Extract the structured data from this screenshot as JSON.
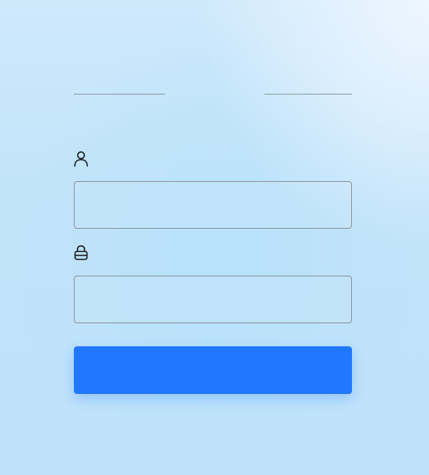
{
  "login": {
    "divider_text": "",
    "username": {
      "icon": "user-icon",
      "label": "",
      "value": "",
      "placeholder": ""
    },
    "password": {
      "icon": "lock-icon",
      "label": "",
      "value": "",
      "placeholder": ""
    },
    "submit_label": ""
  },
  "colors": {
    "accent": "#2177ff",
    "input_border": "#8d939a",
    "divider": "#8e9aa3",
    "background": "#c0e3fa"
  }
}
